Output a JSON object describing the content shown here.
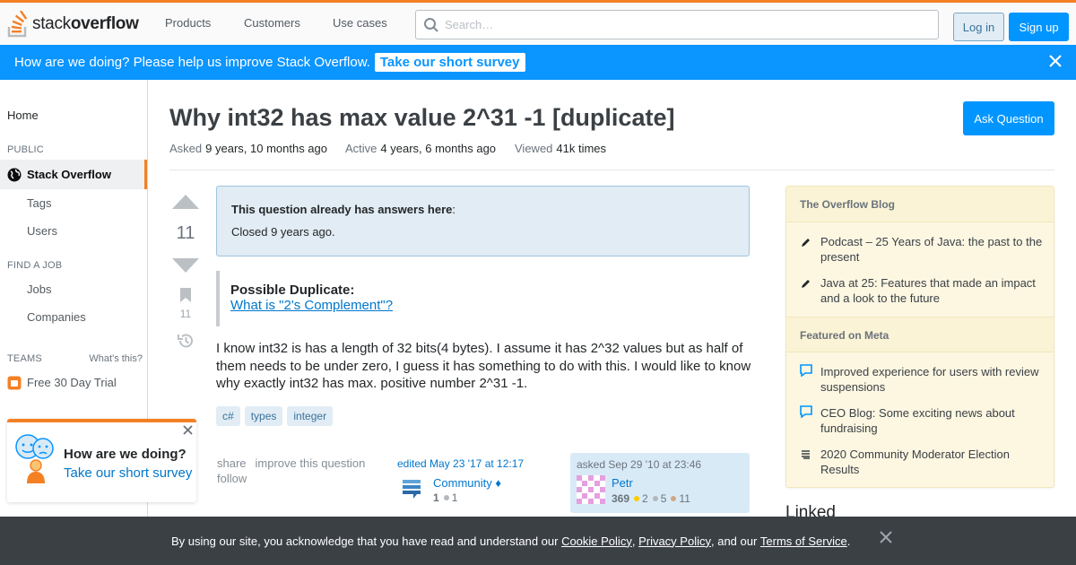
{
  "header": {
    "logo_text_light": "stack",
    "logo_text_bold": "overflow",
    "nav": [
      "Products",
      "Customers",
      "Use cases"
    ],
    "search_placeholder": "Search…",
    "login_label": "Log in",
    "signup_label": "Sign up"
  },
  "banner": {
    "text": "How are we doing? Please help us improve Stack Overflow.",
    "link": "Take our short survey"
  },
  "sidebar": {
    "home": "Home",
    "public_heading": "PUBLIC",
    "active_item": "Stack Overflow",
    "public_items": [
      "Tags",
      "Users"
    ],
    "job_heading": "FIND A JOB",
    "job_items": [
      "Jobs",
      "Companies"
    ],
    "teams_heading": "TEAMS",
    "teams_whats": "What's this?",
    "teams_item": "Free 30 Day Trial",
    "survey_title": "How are we doing?",
    "survey_link": "Take our short survey"
  },
  "question": {
    "title": "Why int32 has max value 2^31 -1 [duplicate]",
    "ask_button": "Ask Question",
    "asked_label": "Asked",
    "asked_value": "9 years, 10 months ago",
    "active_label": "Active",
    "active_value": "4 years, 6 months ago",
    "viewed_label": "Viewed",
    "viewed_value": "41k times",
    "votes": "11",
    "favorites": "11",
    "dup_notice_bold": "This question already has answers here",
    "dup_notice_colon": ":",
    "closed_text": "Closed 9 years ago.",
    "quote_title": "Possible Duplicate:",
    "quote_link": "What is \"2's Complement\"?",
    "body": "I know int32 is has a length of 32 bits(4 bytes). I assume it has 2^32 values but as half of them needs to be under zero, I guess it has something to do with this. I would like to know why exactly int32 has max. positive number 2^31 -1.",
    "tags": [
      "c#",
      "types",
      "integer"
    ],
    "menu_share": "share",
    "menu_improve": "improve this question",
    "menu_follow": "follow",
    "edited_text": "edited May 23 '17 at 12:17",
    "editor_name": "Community ♦",
    "editor_rep": "1",
    "editor_bronze": "1",
    "asked_text": "asked Sep 29 '10 at 23:46",
    "author_name": "Petr",
    "author_rep": "369",
    "author_gold": "2",
    "author_silver": "5",
    "author_bronze": "11"
  },
  "blog": {
    "heading1": "The Overflow Blog",
    "items1": [
      "Podcast – 25 Years of Java: the past to the present",
      "Java at 25: Features that made an impact and a look to the future"
    ],
    "heading2": "Featured on Meta",
    "items2": [
      "Improved experience for users with review suspensions",
      "CEO Blog: Some exciting news about fundraising",
      "2020 Community Moderator Election Results"
    ],
    "linked_heading": "Linked"
  },
  "cookie": {
    "text1": "By using our site, you acknowledge that you have read and understand our ",
    "cookie_policy": "Cookie Policy",
    "sep1": ", ",
    "privacy_policy": "Privacy Policy",
    "text2": ", and our ",
    "terms": "Terms of Service",
    "text3": "."
  },
  "colors": {
    "brand_orange": "#f48024",
    "primary_blue": "#0095ff",
    "link_blue": "#0077cc"
  }
}
